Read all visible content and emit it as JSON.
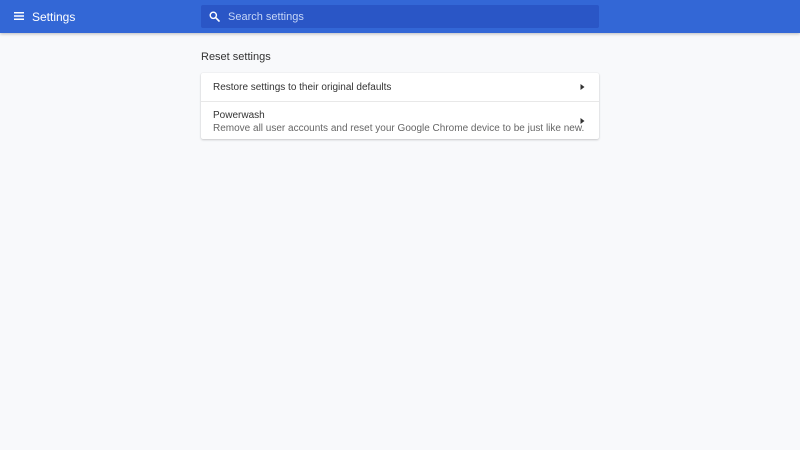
{
  "toolbar": {
    "title": "Settings",
    "menu_icon": "hamburger-menu-icon",
    "search_icon": "search-icon",
    "search_placeholder": "Search settings",
    "search_value": "",
    "background_color": "#3367d6",
    "search_background_color": "#2a56c6"
  },
  "section": {
    "title": "Reset settings",
    "items": [
      {
        "label": "Restore settings to their original defaults",
        "icon": "arrow-right-icon"
      },
      {
        "label": "Powerwash",
        "description": "Remove all user accounts and reset your Google Chrome device to be just like new.",
        "icon": "arrow-right-icon"
      }
    ]
  }
}
